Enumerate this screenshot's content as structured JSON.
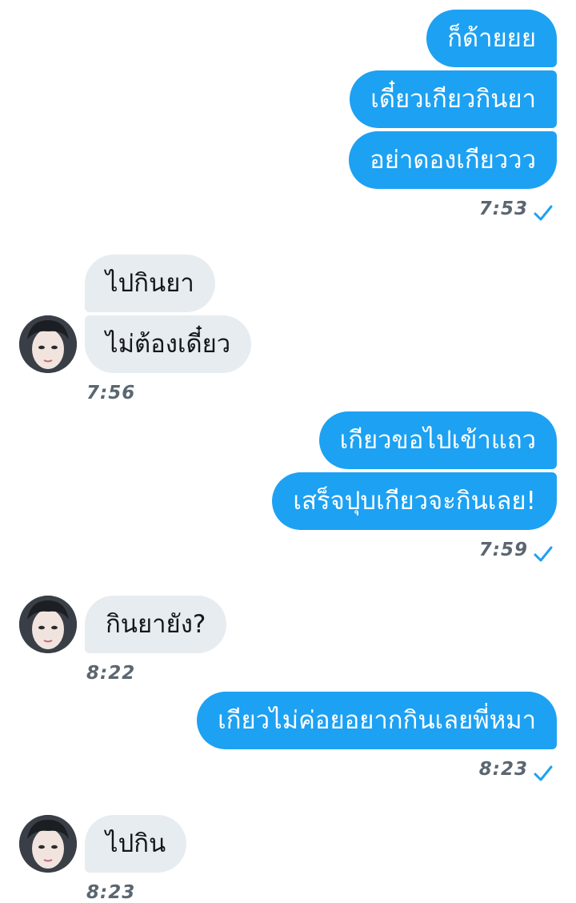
{
  "colors": {
    "outgoing_bubble": "#1da1f2",
    "incoming_bubble": "#e6ecf0",
    "timestamp": "#5b6670",
    "check": "#1da1f2"
  },
  "messages": [
    {
      "dir": "out",
      "text": "ก็ด้ายยย"
    },
    {
      "dir": "out",
      "text": "เดี๋ยวเกียวกินยา"
    },
    {
      "dir": "out",
      "text": "อย่าดองเกียววว"
    },
    {
      "dir": "out_time",
      "time": "7:53"
    },
    {
      "dir": "in",
      "text": "ไปกินยา"
    },
    {
      "dir": "in",
      "text": "ไม่ต้องเดี๋ยว"
    },
    {
      "dir": "in_time",
      "time": "7:56"
    },
    {
      "dir": "out",
      "text": "เกียวขอไปเข้าแถว"
    },
    {
      "dir": "out",
      "text": "เสร็จปุบเกียวจะกินเลย!"
    },
    {
      "dir": "out_time",
      "time": "7:59"
    },
    {
      "dir": "in",
      "text": "กินยายัง?"
    },
    {
      "dir": "in_time",
      "time": "8:22"
    },
    {
      "dir": "out",
      "text": "เกียวไม่ค่อยอยากกินเลยพี่หมา"
    },
    {
      "dir": "out_time",
      "time": "8:23"
    },
    {
      "dir": "in",
      "text": "ไปกิน"
    },
    {
      "dir": "in_time",
      "time": "8:23"
    }
  ],
  "icons": {
    "check": "check-icon",
    "avatar": "avatar"
  }
}
